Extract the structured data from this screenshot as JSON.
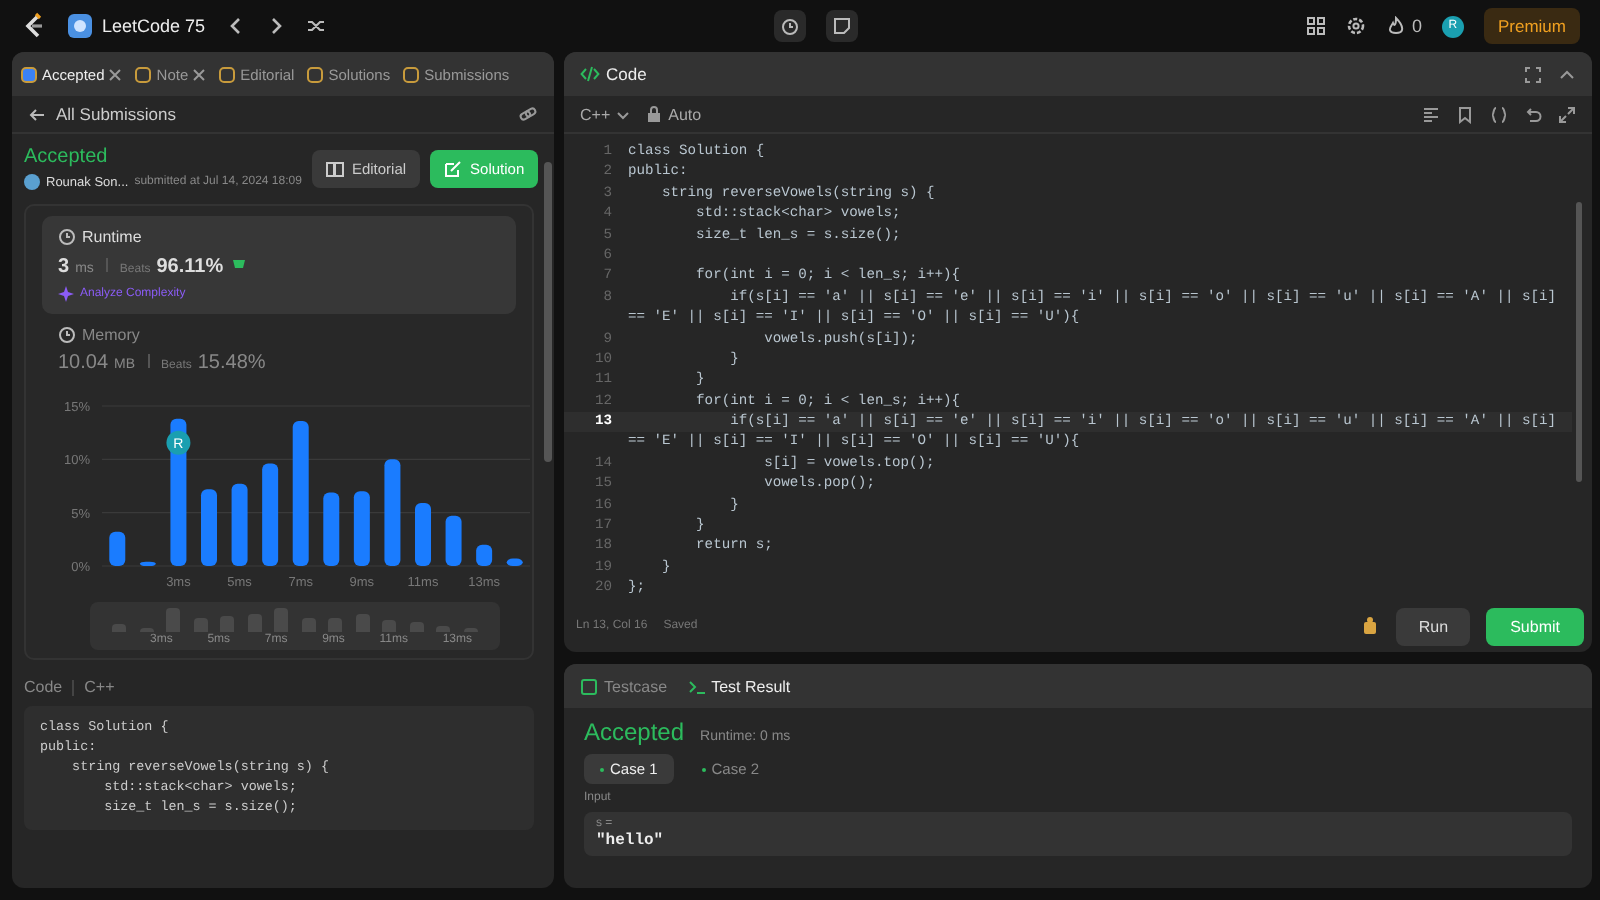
{
  "top_bar": {
    "problem_list": "LeetCode 75",
    "streak": "0",
    "avatar": "R",
    "premium": "Premium"
  },
  "left_panel": {
    "tabs": [
      {
        "label": "Accepted",
        "selected": true,
        "closable": true
      },
      {
        "label": "Note",
        "selected": false,
        "closable": true
      },
      {
        "label": "Editorial",
        "selected": false,
        "closable": false
      },
      {
        "label": "Solutions",
        "selected": false,
        "closable": false
      },
      {
        "label": "Submissions",
        "selected": false,
        "closable": false
      }
    ],
    "back_link": "All Submissions",
    "status": "Accepted",
    "author": "Rounak Son...",
    "submitted": "submitted at Jul 14, 2024 18:09",
    "buttons": [
      {
        "label": "Editorial",
        "kind": "secondary"
      },
      {
        "label": "Solution",
        "kind": "primary"
      }
    ],
    "metrics": [
      {
        "title": "Runtime",
        "value": "3",
        "unit": "ms",
        "beats_label": "Beats",
        "beats": "96.11%",
        "selected": true,
        "link": "Analyze Complexity"
      },
      {
        "title": "Memory",
        "value": "10.04",
        "unit": "MB",
        "beats_label": "Beats",
        "beats": "15.48%",
        "selected": false
      }
    ],
    "chart_data": {
      "type": "bar",
      "x": [
        1,
        2,
        3,
        4,
        5,
        6,
        7,
        8,
        9,
        10,
        11,
        12,
        13,
        14
      ],
      "values": [
        3.2,
        0.4,
        13.8,
        7.2,
        7.7,
        9.6,
        13.6,
        6.9,
        7.0,
        10.0,
        5.9,
        4.7,
        2.0,
        0.7
      ],
      "xlim": [
        0.5,
        14.5
      ],
      "ylim": [
        0,
        15
      ],
      "yticks": [
        {
          "value": 0,
          "label": "0%"
        },
        {
          "value": 5,
          "label": "5%"
        },
        {
          "value": 10,
          "label": "10%"
        },
        {
          "value": 15,
          "label": "15%"
        }
      ],
      "xticks": [
        {
          "value": 3,
          "label": "3ms"
        },
        {
          "value": 5,
          "label": "5ms"
        },
        {
          "value": 7,
          "label": "7ms"
        },
        {
          "value": 9,
          "label": "9ms"
        },
        {
          "value": 11,
          "label": "11ms"
        },
        {
          "value": 13,
          "label": "13ms"
        }
      ],
      "annotations": [
        {
          "x": 3,
          "text": "R"
        }
      ]
    },
    "minimap_labels": [
      "3ms",
      "5ms",
      "7ms",
      "9ms",
      "11ms",
      "13ms"
    ],
    "code_label": "Code",
    "code_language": "C++",
    "code_lines": [
      "class Solution {",
      "public:",
      "    string reverseVowels(string s) {",
      "        std::stack<char> vowels;",
      "        size_t len_s = s.size();"
    ]
  },
  "editor": {
    "title": "Code",
    "language": "C++",
    "mode": "Auto",
    "lines": [
      {
        "number": "1",
        "text": "class Solution {",
        "current": false
      },
      {
        "number": "2",
        "text": "public:",
        "current": false
      },
      {
        "number": "3",
        "text": "    string reverseVowels(string s) {",
        "current": false
      },
      {
        "number": "4",
        "text": "        std::stack<char> vowels;",
        "current": false
      },
      {
        "number": "5",
        "text": "        size_t len_s = s.size();",
        "current": false
      },
      {
        "number": "6",
        "current": false
      },
      {
        "number": "7",
        "text": "        for(int i = 0; i < len_s; i++){",
        "current": false
      },
      {
        "number": "8",
        "text": "            if(s[i] == 'a' || s[i] == 'e' || s[i] == 'i' || s[i] == 'o' || s[i] == 'u' || s[i] == 'A' || s[i]",
        "current": false
      },
      {
        "text": "== 'E' || s[i] == 'I' || s[i] == 'O' || s[i] == 'U'){"
      },
      {
        "number": "9",
        "text": "                vowels.push(s[i]);",
        "current": false
      },
      {
        "number": "10",
        "text": "            }",
        "current": false
      },
      {
        "number": "11",
        "text": "        }",
        "current": false
      },
      {
        "number": "12",
        "text": "        for(int i = 0; i < len_s; i++){",
        "current": false
      },
      {
        "number": "13",
        "text": "            if(s[i] == 'a' || s[i] == 'e' || s[i] == 'i' || s[i] == 'o' || s[i] == 'u' || s[i] == 'A' || s[i]",
        "current": true
      },
      {
        "text": "== 'E' || s[i] == 'I' || s[i] == 'O' || s[i] == 'U'){"
      },
      {
        "number": "14",
        "text": "                s[i] = vowels.top();",
        "current": false
      },
      {
        "number": "15",
        "text": "                vowels.pop();",
        "current": false
      },
      {
        "number": "16",
        "text": "            }",
        "current": false
      },
      {
        "number": "17",
        "text": "        }",
        "current": false
      },
      {
        "number": "18",
        "text": "        return s;",
        "current": false
      },
      {
        "number": "19",
        "text": "    }",
        "current": false
      },
      {
        "number": "20",
        "text": "};",
        "current": false
      }
    ],
    "cursor": "Ln 13, Col 16",
    "save_state": "Saved",
    "run": "Run",
    "submit": "Submit"
  },
  "console": {
    "tabs": [
      {
        "label": "Testcase",
        "selected": false
      },
      {
        "label": "Test Result",
        "selected": true
      }
    ],
    "status": "Accepted",
    "runtime": "Runtime: 0 ms",
    "cases": [
      {
        "label": "Case 1",
        "selected": true
      },
      {
        "label": "Case 2",
        "selected": false
      }
    ],
    "input_label": "Input",
    "variable": "s =",
    "value": "\"hello\""
  }
}
